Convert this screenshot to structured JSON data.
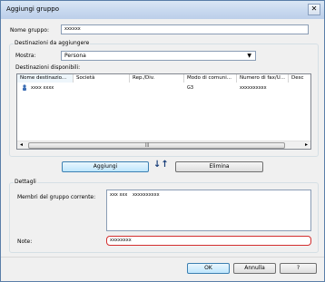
{
  "window": {
    "title": "Aggiungi gruppo",
    "close": "✕"
  },
  "group_name": {
    "label": "Nome gruppo:",
    "value": "xxxxxx"
  },
  "destinations": {
    "title": "Destinazioni da aggiungere",
    "show_label": "Mostra:",
    "show_value": "Persona",
    "available_label": "Destinazioni disponibili:",
    "columns": [
      "Nome destinazio...",
      "Società",
      "Rep./Div.",
      "Modo di comuni...",
      "Numero di fax/U...",
      "Desc"
    ],
    "rows": [
      {
        "name": "xxxx xxxx",
        "company": "",
        "dept": "",
        "mode": "G3",
        "number": "xxxxxxxxxx",
        "desc": ""
      }
    ],
    "scroll_grip": "|||"
  },
  "buttons": {
    "add": "Aggiungi",
    "remove": "Elimina",
    "ok": "OK",
    "cancel": "Annulla",
    "help": "?"
  },
  "arrows": "↓↑",
  "details": {
    "title": "Dettagli",
    "members_label": "Membri del gruppo corrente:",
    "members": [
      {
        "name": "xxx xxx",
        "number": "xxxxxxxxxx"
      }
    ],
    "note_label": "Note:",
    "note_value": "xxxxxxxx"
  }
}
